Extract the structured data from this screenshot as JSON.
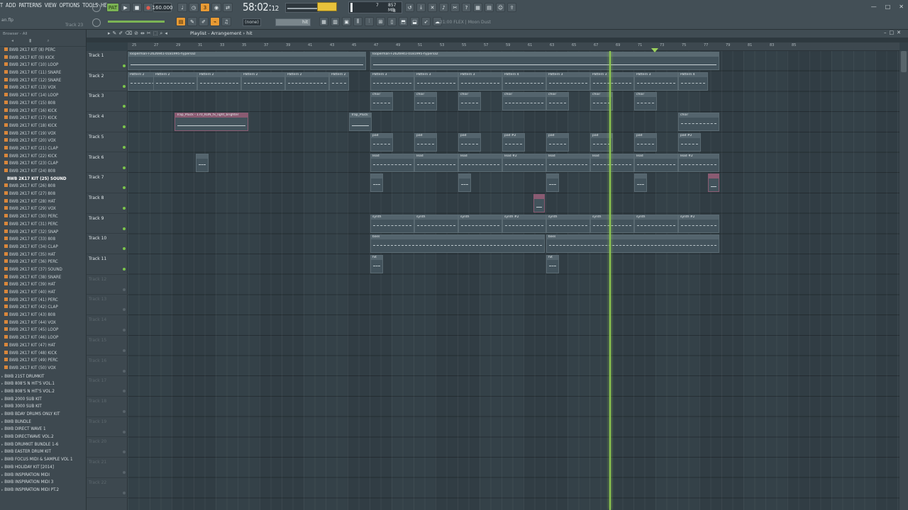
{
  "menu": [
    "T",
    "ADD",
    "PATTERNS",
    "VIEW",
    "OPTIONS",
    "TOOLS",
    "HELP"
  ],
  "song_name": "an.flp",
  "track_hint": "Track 23",
  "transport": {
    "pattern_label": "PAT",
    "tempo": "160.000",
    "time": "58:02",
    "time_sub": "12",
    "cpu_mem": "857 MB",
    "cpu_voices": "8",
    "cpu_count": "7"
  },
  "snap_label": "(none)",
  "snap_value": "hit",
  "news": "21:00  FLEX | Moon Dust",
  "browser": {
    "header": "Browser - All",
    "items": [
      {
        "label": "BWB 2K17 KIT (8) PERC",
        "kind": "sub"
      },
      {
        "label": "BWB 2K17 KIT (9) KICK",
        "kind": "sub"
      },
      {
        "label": "BWB 2K17 KIT (10) LOOP",
        "kind": "sub"
      },
      {
        "label": "BWB 2K17 KIT (11) SNARE",
        "kind": "sub"
      },
      {
        "label": "BWB 2K17 KIT (12) SNARE",
        "kind": "sub"
      },
      {
        "label": "BWB 2K17 KIT (13) VOX",
        "kind": "sub"
      },
      {
        "label": "BWB 2K17 KIT (14) LOOP",
        "kind": "sub"
      },
      {
        "label": "BWB 2K17 KIT (15) 808",
        "kind": "sub"
      },
      {
        "label": "BWB 2K17 KIT (16) KICK",
        "kind": "sub"
      },
      {
        "label": "BWB 2K17 KIT (17) KICK",
        "kind": "sub"
      },
      {
        "label": "BWB 2K17 KIT (18) KICK",
        "kind": "sub"
      },
      {
        "label": "BWB 2K17 KIT (19) VOX",
        "kind": "sub"
      },
      {
        "label": "BWB 2K17 KIT (20) VOX",
        "kind": "sub"
      },
      {
        "label": "BWB 2K17 KIT (21) CLAP",
        "kind": "sub"
      },
      {
        "label": "BWB 2K17 KIT (22) KICK",
        "kind": "sub"
      },
      {
        "label": "BWB 2K17 KIT (23) CLAP",
        "kind": "sub"
      },
      {
        "label": "BWB 2K17 KIT (24) 808",
        "kind": "sub"
      },
      {
        "label": "BWB 2K17 KIT (25) SOUND",
        "kind": "sel"
      },
      {
        "label": "BWB 2K17 KIT (26) 808",
        "kind": "sub"
      },
      {
        "label": "BWB 2K17 KIT (27) 808",
        "kind": "sub"
      },
      {
        "label": "BWB 2K17 KIT (28) HAT",
        "kind": "sub"
      },
      {
        "label": "BWB 2K17 KIT (29) VOX",
        "kind": "sub"
      },
      {
        "label": "BWB 2K17 KIT (30) PERC",
        "kind": "sub"
      },
      {
        "label": "BWB 2K17 KIT (31) PERC",
        "kind": "sub"
      },
      {
        "label": "BWB 2K17 KIT (32) SNAP",
        "kind": "sub"
      },
      {
        "label": "BWB 2K17 KIT (33) 808",
        "kind": "sub"
      },
      {
        "label": "BWB 2K17 KIT (34) CLAP",
        "kind": "sub"
      },
      {
        "label": "BWB 2K17 KIT (35) HAT",
        "kind": "sub"
      },
      {
        "label": "BWB 2K17 KIT (36) PERC",
        "kind": "sub"
      },
      {
        "label": "BWB 2K17 KIT (37) SOUND",
        "kind": "sub"
      },
      {
        "label": "BWB 2K17 KIT (38) SNARE",
        "kind": "sub"
      },
      {
        "label": "BWB 2K17 KIT (39) HAT",
        "kind": "sub"
      },
      {
        "label": "BWB 2K17 KIT (40) HAT",
        "kind": "sub"
      },
      {
        "label": "BWB 2K17 KIT (41) PERC",
        "kind": "sub"
      },
      {
        "label": "BWB 2K17 KIT (42) CLAP",
        "kind": "sub"
      },
      {
        "label": "BWB 2K17 KIT (43) 808",
        "kind": "sub"
      },
      {
        "label": "BWB 2K17 KIT (44) VOX",
        "kind": "sub"
      },
      {
        "label": "BWB 2K17 KIT (45) LOOP",
        "kind": "sub"
      },
      {
        "label": "BWB 2K17 KIT (46) LOOP",
        "kind": "sub"
      },
      {
        "label": "BWB 2K17 KIT (47) HAT",
        "kind": "sub"
      },
      {
        "label": "BWB 2K17 KIT (48) KICK",
        "kind": "sub"
      },
      {
        "label": "BWB 2K17 KIT (49) PERC",
        "kind": "sub"
      },
      {
        "label": "BWB 2K17 KIT (50) VOX",
        "kind": "sub"
      },
      {
        "label": "BWB 21ST DRUMKIT",
        "kind": "folder"
      },
      {
        "label": "BWB 808'S N HIT'S VOL.1",
        "kind": "folder"
      },
      {
        "label": "BWB 808'S N HIT'S VOL.2",
        "kind": "folder"
      },
      {
        "label": "BWB 2000 SUB KIT",
        "kind": "folder"
      },
      {
        "label": "BWB 3000 SUB KIT",
        "kind": "folder"
      },
      {
        "label": "BWB BDAY DRUMS ONLY KIT",
        "kind": "folder"
      },
      {
        "label": "BWB BUNDLE",
        "kind": "folder"
      },
      {
        "label": "BWB DIRECT WAVE 1",
        "kind": "folder"
      },
      {
        "label": "BWB DIRECTWAVE VOL.2",
        "kind": "folder"
      },
      {
        "label": "BWB DRUMKIT BUNDLE 1-6",
        "kind": "folder"
      },
      {
        "label": "BWB EASTER DRUM KIT",
        "kind": "folder"
      },
      {
        "label": "BWB FOCUS MIDI & SAMPLE VOL 1",
        "kind": "folder"
      },
      {
        "label": "BWB HOLIDAY KIT [2014]",
        "kind": "folder"
      },
      {
        "label": "BWB INSPIRATION MIDI",
        "kind": "folder"
      },
      {
        "label": "BWB INSPIRATION MIDI 3",
        "kind": "folder"
      },
      {
        "label": "BWB INSPIRATION MIDI PT.2",
        "kind": "folder"
      }
    ]
  },
  "playlist": {
    "title": "Playlist - Arrangement › hit",
    "ruler": [
      "25",
      "27",
      "29",
      "31",
      "33",
      "35",
      "37",
      "39",
      "41",
      "43",
      "45",
      "47",
      "49",
      "51",
      "53",
      "55",
      "57",
      "59",
      "61",
      "63",
      "65",
      "67",
      "69",
      "71",
      "73",
      "75",
      "77",
      "79",
      "81",
      "83",
      "85"
    ],
    "tracks": [
      "Track 1",
      "Track 2",
      "Track 3",
      "Track 4",
      "Track 5",
      "Track 6",
      "Track 7",
      "Track 8",
      "Track 9",
      "Track 10",
      "Track 11",
      "Track 12",
      "Track 13",
      "Track 14",
      "Track 15",
      "Track 16",
      "Track 17",
      "Track 18",
      "Track 19",
      "Track 20",
      "Track 21",
      "Track 22"
    ],
    "clips": [
      {
        "track": 0,
        "start": 0,
        "width": 336,
        "label": "looperman-l-2626941-0181995-hypersaz",
        "type": "audio"
      },
      {
        "track": 0,
        "start": 342,
        "width": 492,
        "label": "looperman-l-2626941-0181995-hypersaz",
        "type": "audio"
      },
      {
        "track": 1,
        "start": 0,
        "width": 62,
        "label": "Pattern 2",
        "type": "pattern"
      },
      {
        "track": 1,
        "start": 36,
        "width": 62,
        "label": "Pattern 2",
        "type": "pattern"
      },
      {
        "track": 1,
        "start": 98,
        "width": 62,
        "label": "Pattern 2",
        "type": "pattern"
      },
      {
        "track": 1,
        "start": 160,
        "width": 62,
        "label": "Pattern 2",
        "type": "pattern"
      },
      {
        "track": 1,
        "start": 222,
        "width": 62,
        "label": "Pattern 2",
        "type": "pattern"
      },
      {
        "track": 1,
        "start": 284,
        "width": 28,
        "label": "Pattern 2",
        "type": "pattern"
      },
      {
        "track": 1,
        "start": 342,
        "width": 62,
        "label": "Pattern 3",
        "type": "pattern"
      },
      {
        "track": 1,
        "start": 404,
        "width": 62,
        "label": "Pattern 3",
        "type": "pattern"
      },
      {
        "track": 1,
        "start": 466,
        "width": 62,
        "label": "Pattern 3",
        "type": "pattern"
      },
      {
        "track": 1,
        "start": 528,
        "width": 62,
        "label": "Pattern 4",
        "type": "pattern"
      },
      {
        "track": 1,
        "start": 590,
        "width": 62,
        "label": "Pattern 3",
        "type": "pattern"
      },
      {
        "track": 1,
        "start": 652,
        "width": 62,
        "label": "Pattern 3",
        "type": "pattern"
      },
      {
        "track": 1,
        "start": 714,
        "width": 62,
        "label": "Pattern 3",
        "type": "pattern"
      },
      {
        "track": 1,
        "start": 776,
        "width": 42,
        "label": "Pattern 4",
        "type": "pattern"
      },
      {
        "track": 2,
        "start": 342,
        "width": 32,
        "label": "choir",
        "type": "pattern"
      },
      {
        "track": 2,
        "start": 404,
        "width": 32,
        "label": "choir",
        "type": "pattern"
      },
      {
        "track": 2,
        "start": 466,
        "width": 32,
        "label": "choir",
        "type": "pattern"
      },
      {
        "track": 2,
        "start": 528,
        "width": 62,
        "label": "choir",
        "type": "pattern"
      },
      {
        "track": 2,
        "start": 590,
        "width": 32,
        "label": "choir",
        "type": "pattern"
      },
      {
        "track": 2,
        "start": 652,
        "width": 32,
        "label": "choir",
        "type": "pattern"
      },
      {
        "track": 2,
        "start": 714,
        "width": 32,
        "label": "choir",
        "type": "pattern"
      },
      {
        "track": 3,
        "start": 66,
        "width": 104,
        "label": "Trap_Pluck - 170_KUN_fx_light_brighter",
        "type": "pink"
      },
      {
        "track": 3,
        "start": 312,
        "width": 32,
        "label": "Trap_Pluck",
        "type": "audio"
      },
      {
        "track": 3,
        "start": 776,
        "width": 58,
        "label": "choir",
        "type": "pattern"
      },
      {
        "track": 4,
        "start": 342,
        "width": 32,
        "label": "pad",
        "type": "pattern"
      },
      {
        "track": 4,
        "start": 404,
        "width": 32,
        "label": "pad",
        "type": "pattern"
      },
      {
        "track": 4,
        "start": 466,
        "width": 32,
        "label": "pad",
        "type": "pattern"
      },
      {
        "track": 4,
        "start": 528,
        "width": 32,
        "label": "pad #2",
        "type": "pattern"
      },
      {
        "track": 4,
        "start": 590,
        "width": 32,
        "label": "pad",
        "type": "pattern"
      },
      {
        "track": 4,
        "start": 652,
        "width": 32,
        "label": "pad",
        "type": "pattern"
      },
      {
        "track": 4,
        "start": 714,
        "width": 32,
        "label": "pad",
        "type": "pattern"
      },
      {
        "track": 4,
        "start": 776,
        "width": 32,
        "label": "pad #2",
        "type": "pattern"
      },
      {
        "track": 5,
        "start": 96,
        "width": 18,
        "label": "",
        "type": "pattern"
      },
      {
        "track": 5,
        "start": 342,
        "width": 62,
        "label": "lead",
        "type": "pattern"
      },
      {
        "track": 5,
        "start": 404,
        "width": 62,
        "label": "lead",
        "type": "pattern"
      },
      {
        "track": 5,
        "start": 466,
        "width": 62,
        "label": "lead",
        "type": "pattern"
      },
      {
        "track": 5,
        "start": 528,
        "width": 62,
        "label": "lead #2",
        "type": "pattern"
      },
      {
        "track": 5,
        "start": 590,
        "width": 62,
        "label": "lead",
        "type": "pattern"
      },
      {
        "track": 5,
        "start": 652,
        "width": 62,
        "label": "lead",
        "type": "pattern"
      },
      {
        "track": 5,
        "start": 714,
        "width": 62,
        "label": "lead",
        "type": "pattern"
      },
      {
        "track": 5,
        "start": 776,
        "width": 58,
        "label": "lead #2",
        "type": "pattern"
      },
      {
        "track": 6,
        "start": 342,
        "width": 18,
        "label": "",
        "type": "pattern"
      },
      {
        "track": 6,
        "start": 466,
        "width": 18,
        "label": "",
        "type": "pattern"
      },
      {
        "track": 6,
        "start": 590,
        "width": 18,
        "label": "",
        "type": "pattern"
      },
      {
        "track": 6,
        "start": 714,
        "width": 18,
        "label": "",
        "type": "pattern"
      },
      {
        "track": 6,
        "start": 818,
        "width": 16,
        "label": "",
        "type": "pink"
      },
      {
        "track": 7,
        "start": 572,
        "width": 16,
        "label": "",
        "type": "pink"
      },
      {
        "track": 8,
        "start": 342,
        "width": 62,
        "label": "synth",
        "type": "pattern"
      },
      {
        "track": 8,
        "start": 404,
        "width": 62,
        "label": "synth",
        "type": "pattern"
      },
      {
        "track": 8,
        "start": 466,
        "width": 62,
        "label": "synth",
        "type": "pattern"
      },
      {
        "track": 8,
        "start": 528,
        "width": 62,
        "label": "synth #2",
        "type": "pattern"
      },
      {
        "track": 8,
        "start": 590,
        "width": 62,
        "label": "synth",
        "type": "pattern"
      },
      {
        "track": 8,
        "start": 652,
        "width": 62,
        "label": "synth",
        "type": "pattern"
      },
      {
        "track": 8,
        "start": 714,
        "width": 62,
        "label": "synth",
        "type": "pattern"
      },
      {
        "track": 8,
        "start": 776,
        "width": 58,
        "label": "synth #2",
        "type": "pattern"
      },
      {
        "track": 9,
        "start": 342,
        "width": 246,
        "label": "bass",
        "type": "pattern"
      },
      {
        "track": 9,
        "start": 590,
        "width": 244,
        "label": "bass",
        "type": "pattern"
      },
      {
        "track": 10,
        "start": 342,
        "width": 18,
        "label": "hit",
        "type": "pattern"
      },
      {
        "track": 10,
        "start": 590,
        "width": 18,
        "label": "hit",
        "type": "pattern"
      }
    ]
  }
}
